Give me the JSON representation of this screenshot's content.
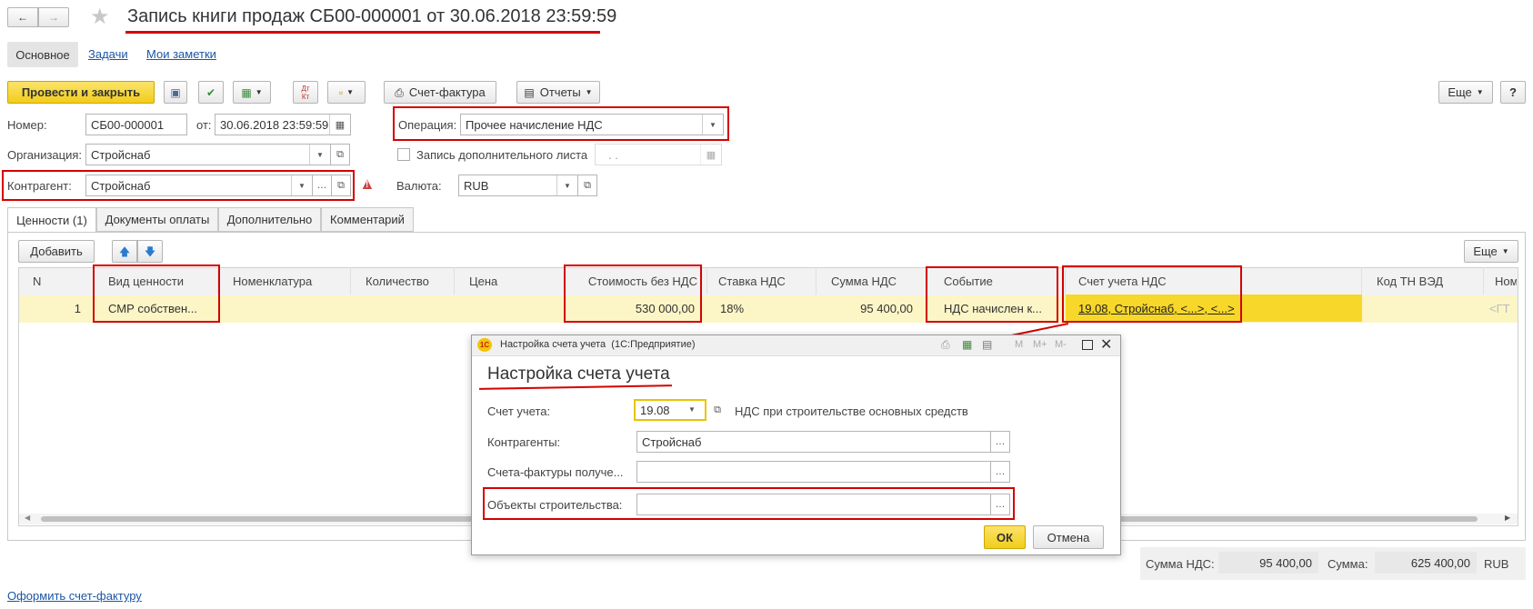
{
  "window": {
    "title": "Запись книги продаж СБ00-000001 от 30.06.2018 23:59:59"
  },
  "nav_tabs": [
    "Основное",
    "Задачи",
    "Мои заметки"
  ],
  "toolbar": {
    "post_close": "Провести и закрыть",
    "dt_kt": "Дт Кт",
    "invoice": "Счет-фактура",
    "reports": "Отчеты",
    "more": "Еще",
    "help": "?"
  },
  "form": {
    "number_label": "Номер:",
    "number_value": "СБ00-000001",
    "date_label": "от:",
    "date_value": "30.06.2018 23:59:59",
    "operation_label": "Операция:",
    "operation_value": "Прочее начисление НДС",
    "org_label": "Организация:",
    "org_value": "Стройснаб",
    "extra_sheet_label": "Запись дополнительного листа",
    "extra_sheet_date": ". .",
    "counterparty_label": "Контрагент:",
    "counterparty_value": "Стройснаб",
    "currency_label": "Валюта:",
    "currency_value": "RUB"
  },
  "doc_tabs": [
    "Ценности (1)",
    "Документы оплаты",
    "Дополнительно",
    "Комментарий"
  ],
  "table_toolbar": {
    "add": "Добавить",
    "more": "Еще"
  },
  "table": {
    "columns": [
      "N",
      "Вид ценности",
      "Номенклатура",
      "Количество",
      "Цена",
      "Стоимость без НДС",
      "Ставка НДС",
      "Сумма НДС",
      "Событие",
      "Счет учета НДС",
      "Код ТН ВЭД",
      "Ном"
    ],
    "rows": [
      {
        "n": "1",
        "value_type": "СМР собствен...",
        "nomenclature": "",
        "quantity": "",
        "price": "",
        "cost": "530 000,00",
        "rate": "18%",
        "vat": "95 400,00",
        "event": "НДС начислен к...",
        "account": "19.08, Стройснаб, <...>, <...>",
        "tnved": "",
        "nom": "<ГТ"
      }
    ]
  },
  "totals": {
    "vat_label": "Сумма НДС:",
    "vat_value": "95 400,00",
    "sum_label": "Сумма:",
    "sum_value": "625 400,00",
    "currency": "RUB"
  },
  "footer_link": "Оформить счет-фактуру",
  "dialog": {
    "window_title": "Настройка счета учета  (1С:Предприятие)",
    "logo": "1С",
    "title": "Настройка счета учета",
    "account_label": "Счет учета:",
    "account_value": "19.08",
    "account_desc": "НДС при строительстве основных средств",
    "counterparties_label": "Контрагенты:",
    "counterparties_value": "Стройснаб",
    "invoices_label": "Счета-фактуры получе...",
    "invoices_value": "",
    "objects_label": "Объекты строительства:",
    "objects_value": "",
    "ok": "ОК",
    "cancel": "Отмена",
    "tb_m": "M",
    "tb_mplus": "M+",
    "tb_mminus": "M-"
  },
  "colors": {
    "accent_yellow": "#f7d72a",
    "row_highlight": "#fcf5c6",
    "annotation_red": "#d40000",
    "link_blue": "#1a56a6"
  }
}
